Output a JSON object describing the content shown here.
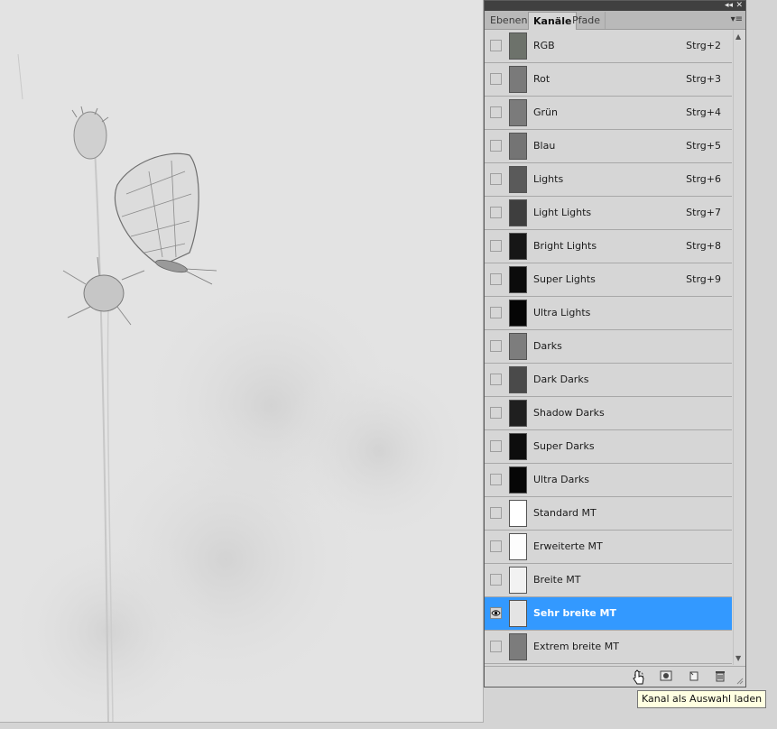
{
  "panel": {
    "tabs": [
      {
        "label": "Ebenen",
        "active": false
      },
      {
        "label": "Kanäle",
        "active": true
      },
      {
        "label": "Pfade",
        "active": false
      }
    ],
    "controls": {
      "collapse": "◂◂",
      "close": "✕",
      "menu": "▾≡"
    },
    "channels": [
      {
        "name": "RGB",
        "shortcut": "Strg+2",
        "thumb": "#6d726b",
        "visible": false,
        "selected": false
      },
      {
        "name": "Rot",
        "shortcut": "Strg+3",
        "thumb": "#7a7a7a",
        "visible": false,
        "selected": false
      },
      {
        "name": "Grün",
        "shortcut": "Strg+4",
        "thumb": "#7b7b7b",
        "visible": false,
        "selected": false
      },
      {
        "name": "Blau",
        "shortcut": "Strg+5",
        "thumb": "#747474",
        "visible": false,
        "selected": false
      },
      {
        "name": "Lights",
        "shortcut": "Strg+6",
        "thumb": "#5a5a5a",
        "visible": false,
        "selected": false
      },
      {
        "name": "Light Lights",
        "shortcut": "Strg+7",
        "thumb": "#3e3e3e",
        "visible": false,
        "selected": false
      },
      {
        "name": "Bright Lights",
        "shortcut": "Strg+8",
        "thumb": "#161616",
        "visible": false,
        "selected": false
      },
      {
        "name": "Super Lights",
        "shortcut": "Strg+9",
        "thumb": "#0b0b0b",
        "visible": false,
        "selected": false
      },
      {
        "name": "Ultra Lights",
        "shortcut": "",
        "thumb": "#050505",
        "visible": false,
        "selected": false
      },
      {
        "name": "Darks",
        "shortcut": "",
        "thumb": "#7d7d7d",
        "visible": false,
        "selected": false
      },
      {
        "name": "Dark Darks",
        "shortcut": "",
        "thumb": "#4a4a4a",
        "visible": false,
        "selected": false
      },
      {
        "name": "Shadow Darks",
        "shortcut": "",
        "thumb": "#1f1f1f",
        "visible": false,
        "selected": false
      },
      {
        "name": "Super Darks",
        "shortcut": "",
        "thumb": "#0d0d0d",
        "visible": false,
        "selected": false
      },
      {
        "name": "Ultra Darks",
        "shortcut": "",
        "thumb": "#060606",
        "visible": false,
        "selected": false
      },
      {
        "name": "Standard MT",
        "shortcut": "",
        "thumb": "#ffffff",
        "visible": false,
        "selected": false
      },
      {
        "name": "Erweiterte MT",
        "shortcut": "",
        "thumb": "#fdfdfd",
        "visible": false,
        "selected": false
      },
      {
        "name": "Breite MT",
        "shortcut": "",
        "thumb": "#f2f2f2",
        "visible": false,
        "selected": false
      },
      {
        "name": "Sehr breite MT",
        "shortcut": "",
        "thumb": "#e4e4e4",
        "visible": true,
        "selected": true
      },
      {
        "name": "Extrem breite MT",
        "shortcut": "",
        "thumb": "#7c7c7c",
        "visible": false,
        "selected": false
      }
    ],
    "footer_buttons": [
      "load-channel-as-selection",
      "save-selection-as-channel",
      "new-channel",
      "delete-channel"
    ]
  },
  "tooltip": {
    "text": "Kanal als Auswahl laden"
  },
  "colors": {
    "selection": "#3399ff",
    "panel_bg": "#d6d6d6"
  }
}
